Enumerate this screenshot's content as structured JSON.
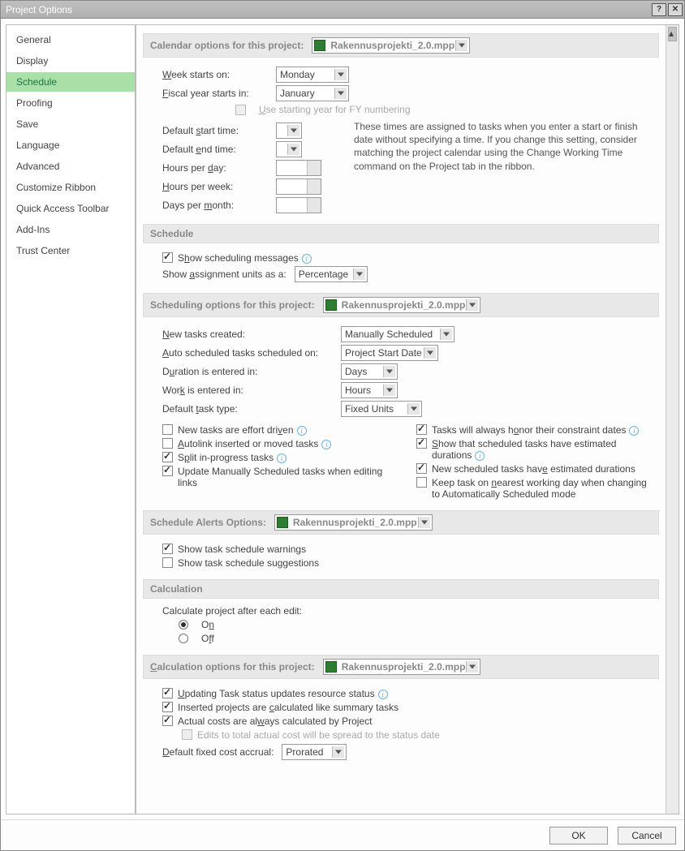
{
  "window": {
    "title": "Project Options"
  },
  "sidebar": {
    "items": [
      "General",
      "Display",
      "Schedule",
      "Proofing",
      "Save",
      "Language",
      "Advanced",
      "Customize Ribbon",
      "Quick Access Toolbar",
      "Add-Ins",
      "Trust Center"
    ],
    "selected_index": 2
  },
  "calendar": {
    "header": "Calendar options for this project:",
    "project_file": "Rakennusprojekti_2.0.mpp",
    "week_starts_label": "Week starts on:",
    "week_starts_value": "Monday",
    "fiscal_starts_label": "Fiscal year starts in:",
    "fiscal_starts_value": "January",
    "use_starting_year_label": "Use starting year for FY numbering",
    "default_start_label": "Default start time:",
    "default_end_label": "Default end time:",
    "hours_per_day_label": "Hours per day:",
    "hours_per_week_label": "Hours per week:",
    "days_per_month_label": "Days per month:",
    "note": "These times are assigned to tasks when you enter a start or finish date without specifying a time.  If you change this setting, consider matching the project calendar using the Change Working Time command on the Project tab in the ribbon."
  },
  "schedule": {
    "header": "Schedule",
    "show_messages_label": "Show scheduling messages",
    "assignment_units_label": "Show assignment units as a:",
    "assignment_units_value": "Percentage"
  },
  "sched_opts": {
    "header": "Scheduling options for this project:",
    "project_file": "Rakennusprojekti_2.0.mpp",
    "new_tasks_label": "New tasks created:",
    "new_tasks_value": "Manually Scheduled",
    "auto_sched_label": "Auto scheduled tasks scheduled on:",
    "auto_sched_value": "Project Start Date",
    "duration_label": "Duration is entered in:",
    "duration_value": "Days",
    "work_label": "Work is entered in:",
    "work_value": "Hours",
    "task_type_label": "Default task type:",
    "task_type_value": "Fixed Units",
    "chk_effort": "New tasks are effort driven",
    "chk_autolink": "Autolink inserted or moved tasks",
    "chk_split": "Split in-progress tasks",
    "chk_update_manual": "Update Manually Scheduled tasks when editing links",
    "chk_honor": "Tasks will always honor their constraint dates",
    "chk_show_est": "Show that scheduled tasks have estimated durations",
    "chk_new_est": "New scheduled tasks have estimated durations",
    "chk_keep_near": "Keep task on nearest working day when changing to Automatically Scheduled mode"
  },
  "alerts": {
    "header": "Schedule Alerts Options:",
    "project_file": "Rakennusprojekti_2.0.mpp",
    "warnings": "Show task schedule warnings",
    "suggestions": "Show task schedule suggestions"
  },
  "calculation": {
    "header": "Calculation",
    "after_edit": "Calculate project after each edit:",
    "on": "On",
    "off": "Off"
  },
  "calc_opts": {
    "header": "Calculation options for this project:",
    "project_file": "Rakennusprojekti_2.0.mpp",
    "chk_update_status": "Updating Task status updates resource status",
    "chk_inserted": "Inserted projects are calculated like summary tasks",
    "chk_actual": "Actual costs are always calculated by Project",
    "chk_edits_total": "Edits to total actual cost will be spread to the status date",
    "accrual_label": "Default fixed cost accrual:",
    "accrual_value": "Prorated"
  },
  "footer": {
    "ok": "OK",
    "cancel": "Cancel"
  }
}
